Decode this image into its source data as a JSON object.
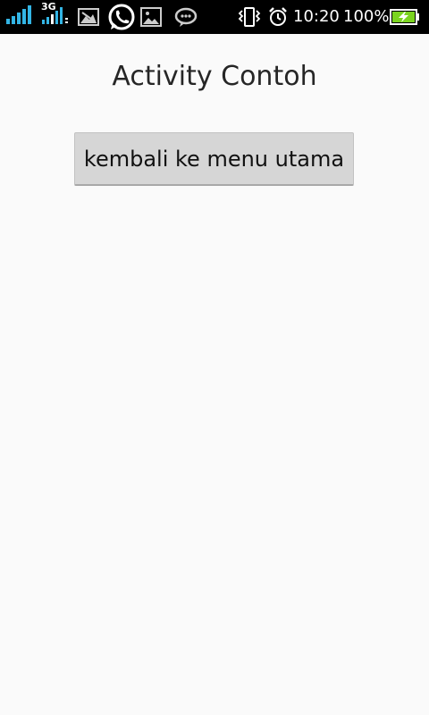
{
  "status_bar": {
    "network_type": "3G",
    "time": "10:20",
    "battery_percent": "100%",
    "battery_level": 1.0,
    "icons": [
      "signal-icon",
      "signal-3g-icon",
      "gallery-notification-icon",
      "whatsapp-icon",
      "image-notification-icon",
      "chat-notification-icon",
      "vibrate-icon",
      "alarm-icon",
      "battery-charging-icon"
    ]
  },
  "activity": {
    "title": "Activity Contoh",
    "back_button_label": "kembali ke menu utama"
  },
  "colors": {
    "status_bar_bg": "#000000",
    "page_bg": "#fafafa",
    "button_bg": "#d6d6d6",
    "signal_blue": "#33b5e5",
    "battery_green": "#7bd420"
  }
}
